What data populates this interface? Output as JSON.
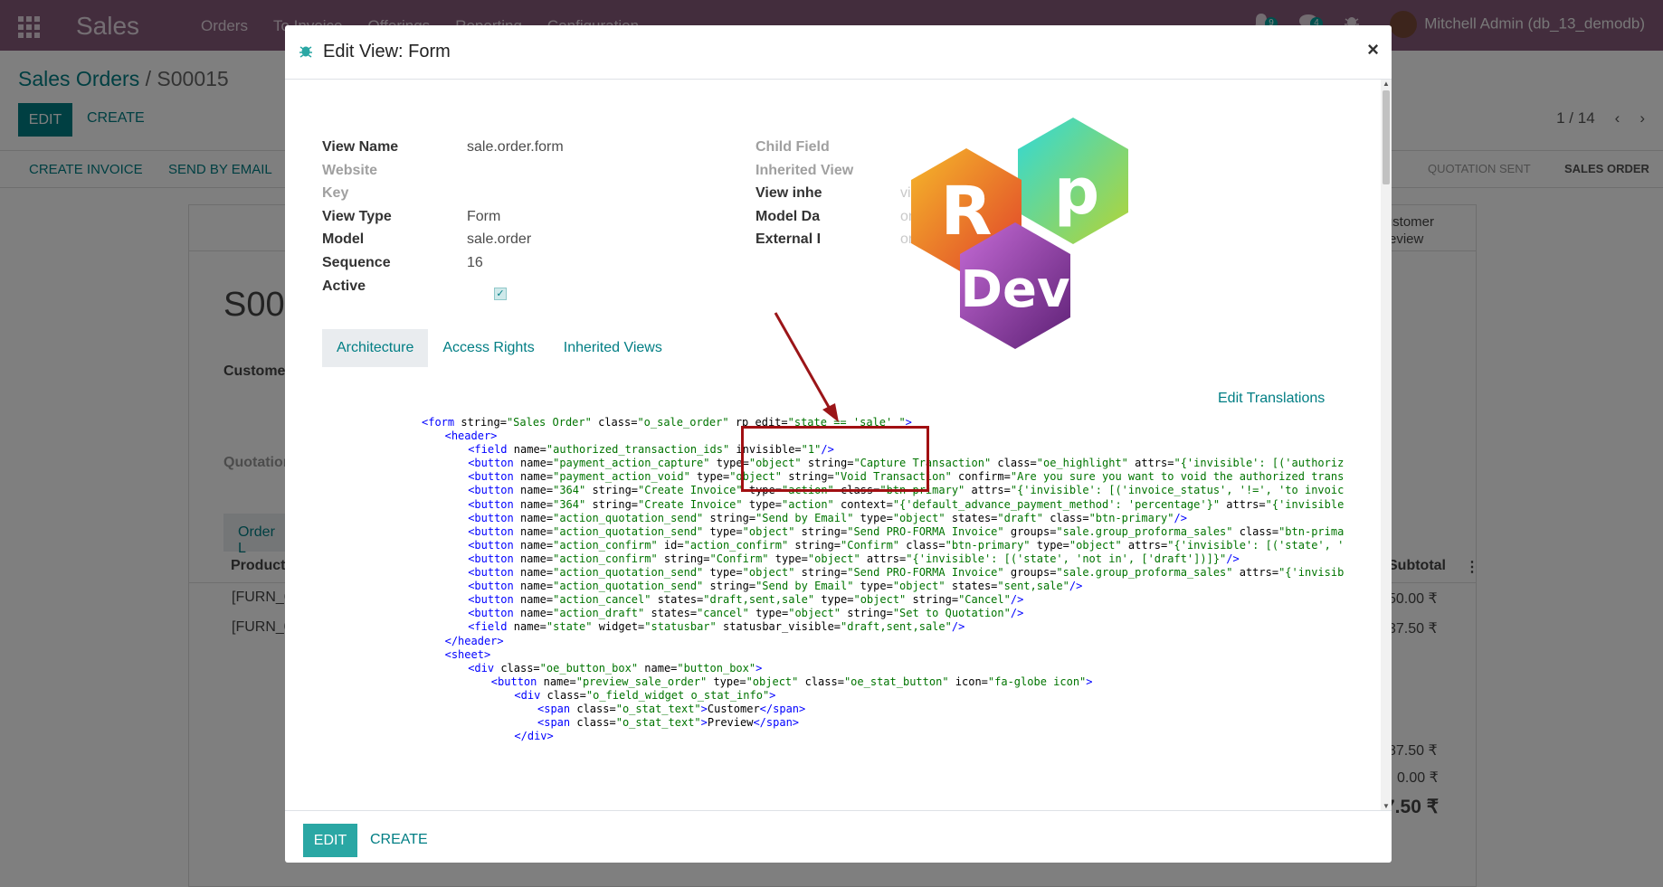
{
  "app": {
    "brand": "Sales",
    "menu": [
      "Orders",
      "To Invoice",
      "Offerings",
      "Reporting",
      "Configuration"
    ],
    "activity_badge": "9",
    "messages_badge": "4",
    "user": "Mitchell Admin (db_13_demodb)"
  },
  "breadcrumb": {
    "root": "Sales Orders",
    "separator": "/",
    "current": "S00015"
  },
  "control": {
    "edit_label": "EDIT",
    "create_label": "CREATE",
    "pager": "1 / 14"
  },
  "status_buttons": [
    "CREATE INVOICE",
    "SEND BY EMAIL"
  ],
  "statusbar": {
    "sent": "QUOTATION SENT",
    "sale": "SALES ORDER"
  },
  "background": {
    "order_number": "S00",
    "customer_label": "Customer",
    "quotation_label": "Quotation",
    "order_lines_tab": "Order L",
    "product_col": "Product",
    "subtotal_col": "Subtotal",
    "customer_preview": "Customer Preview",
    "row1": "[FURN_6",
    "row2": "[FURN_0",
    "amt1": "50.00 ₹",
    "amt2": "37.50 ₹",
    "amt3": "87.50 ₹",
    "amt4": "0.00 ₹",
    "amt5": "7.50 ₹"
  },
  "modal": {
    "title": "Edit View: Form",
    "close": "×",
    "fields_left": [
      {
        "label": "View Name",
        "value": "sale.order.form",
        "muted": false
      },
      {
        "label": "Website",
        "value": "",
        "muted": true
      },
      {
        "label": "Key",
        "value": "",
        "muted": true
      },
      {
        "label": "View Type",
        "value": "Form",
        "muted": false
      },
      {
        "label": "Model",
        "value": "sale.order",
        "muted": false
      },
      {
        "label": "Sequence",
        "value": "16",
        "muted": false
      },
      {
        "label": "Active",
        "value": "",
        "muted": false
      }
    ],
    "fields_right": [
      {
        "label": "Child Field",
        "value": "",
        "muted": true
      },
      {
        "label": "Inherited View",
        "value": "",
        "muted": true
      },
      {
        "label": "View inhe",
        "value": "view",
        "muted": false
      },
      {
        "label": "Model Da",
        "value": "order.form",
        "muted": false
      },
      {
        "label": "External I",
        "value": "order_form",
        "muted": false
      }
    ],
    "active_checked": "✓",
    "tabs": [
      "Architecture",
      "Access Rights",
      "Inherited Views"
    ],
    "edit_translations": "Edit Translations",
    "footer_edit": "EDIT",
    "footer_create": "CREATE",
    "logo_letters": [
      "R",
      "p",
      "Dev"
    ]
  },
  "code_lines": [
    [
      0,
      [
        [
          "t",
          "<form "
        ],
        [
          "a",
          "string="
        ],
        [
          "v",
          "\"Sales Order\""
        ],
        [
          "a",
          " class="
        ],
        [
          "v",
          "\"o_sale_order\""
        ],
        [
          "a",
          " rp_edit="
        ],
        [
          "v",
          "\"state == 'sale' \""
        ],
        [
          "t",
          ">"
        ]
      ]
    ],
    [
      1,
      [
        [
          "t",
          "<header>"
        ]
      ]
    ],
    [
      2,
      [
        [
          "t",
          "<field "
        ],
        [
          "a",
          "name="
        ],
        [
          "v",
          "\"authorized_transaction_ids\""
        ],
        [
          "a",
          " invisible="
        ],
        [
          "v",
          "\"1\""
        ],
        [
          "t",
          "/>"
        ]
      ]
    ],
    [
      2,
      [
        [
          "t",
          "<button "
        ],
        [
          "a",
          "name="
        ],
        [
          "v",
          "\"payment_action_capture\""
        ],
        [
          "a",
          " type="
        ],
        [
          "v",
          "\"object\""
        ],
        [
          "a",
          " string="
        ],
        [
          "v",
          "\"Capture Transaction\""
        ],
        [
          "a",
          " class="
        ],
        [
          "v",
          "\"oe_highlight\""
        ],
        [
          "a",
          " attrs="
        ],
        [
          "v",
          "\"{'invisible': [('authorized_transaction_ids', '=', [])]}\""
        ],
        [
          "t",
          "/>"
        ]
      ]
    ],
    [
      2,
      [
        [
          "t",
          "<button "
        ],
        [
          "a",
          "name="
        ],
        [
          "v",
          "\"payment_action_void\""
        ],
        [
          "a",
          " type="
        ],
        [
          "v",
          "\"object\""
        ],
        [
          "a",
          " string="
        ],
        [
          "v",
          "\"Void Transaction\""
        ],
        [
          "a",
          " confirm="
        ],
        [
          "v",
          "\"Are you sure you want to void the authorized transaction?\""
        ],
        [
          "t",
          "/>"
        ]
      ]
    ],
    [
      2,
      [
        [
          "t",
          "<button "
        ],
        [
          "a",
          "name="
        ],
        [
          "v",
          "\"364\""
        ],
        [
          "a",
          " string="
        ],
        [
          "v",
          "\"Create Invoice\""
        ],
        [
          "a",
          " type="
        ],
        [
          "v",
          "\"action\""
        ],
        [
          "a",
          " class="
        ],
        [
          "v",
          "\"btn-primary\""
        ],
        [
          "a",
          " attrs="
        ],
        [
          "v",
          "\"{'invisible': [('invoice_status', '!=', 'to invoice')]}\""
        ],
        [
          "t",
          "/>"
        ]
      ]
    ],
    [
      2,
      [
        [
          "t",
          "<button "
        ],
        [
          "a",
          "name="
        ],
        [
          "v",
          "\"364\""
        ],
        [
          "a",
          " string="
        ],
        [
          "v",
          "\"Create Invoice\""
        ],
        [
          "a",
          " type="
        ],
        [
          "v",
          "\"action\""
        ],
        [
          "a",
          " context="
        ],
        [
          "v",
          "\"{'default_advance_payment_method': 'percentage'}\""
        ],
        [
          "a",
          " attrs="
        ],
        [
          "v",
          "\"{'invisible': []}\""
        ],
        [
          "t",
          "/>"
        ]
      ]
    ],
    [
      2,
      [
        [
          "t",
          "<button "
        ],
        [
          "a",
          "name="
        ],
        [
          "v",
          "\"action_quotation_send\""
        ],
        [
          "a",
          " string="
        ],
        [
          "v",
          "\"Send by Email\""
        ],
        [
          "a",
          " type="
        ],
        [
          "v",
          "\"object\""
        ],
        [
          "a",
          " states="
        ],
        [
          "v",
          "\"draft\""
        ],
        [
          "a",
          " class="
        ],
        [
          "v",
          "\"btn-primary\""
        ],
        [
          "t",
          "/>"
        ]
      ]
    ],
    [
      2,
      [
        [
          "t",
          "<button "
        ],
        [
          "a",
          "name="
        ],
        [
          "v",
          "\"action_quotation_send\""
        ],
        [
          "a",
          " type="
        ],
        [
          "v",
          "\"object\""
        ],
        [
          "a",
          " string="
        ],
        [
          "v",
          "\"Send PRO-FORMA Invoice\""
        ],
        [
          "a",
          " groups="
        ],
        [
          "v",
          "\"sale.group_proforma_sales\""
        ],
        [
          "a",
          " class="
        ],
        [
          "v",
          "\"btn-primary\""
        ],
        [
          "t",
          "/>"
        ]
      ]
    ],
    [
      2,
      [
        [
          "t",
          "<button "
        ],
        [
          "a",
          "name="
        ],
        [
          "v",
          "\"action_confirm\""
        ],
        [
          "a",
          " id="
        ],
        [
          "v",
          "\"action_confirm\""
        ],
        [
          "a",
          " string="
        ],
        [
          "v",
          "\"Confirm\""
        ],
        [
          "a",
          " class="
        ],
        [
          "v",
          "\"btn-primary\""
        ],
        [
          "a",
          " type="
        ],
        [
          "v",
          "\"object\""
        ],
        [
          "a",
          " attrs="
        ],
        [
          "v",
          "\"{'invisible': [('state', 'not in', ['sent'])]}\""
        ],
        [
          "t",
          "/>"
        ]
      ]
    ],
    [
      2,
      [
        [
          "t",
          "<button "
        ],
        [
          "a",
          "name="
        ],
        [
          "v",
          "\"action_confirm\""
        ],
        [
          "a",
          " string="
        ],
        [
          "v",
          "\"Confirm\""
        ],
        [
          "a",
          " type="
        ],
        [
          "v",
          "\"object\""
        ],
        [
          "a",
          " attrs="
        ],
        [
          "v",
          "\"{'invisible': [('state', 'not in', ['draft'])]}\""
        ],
        [
          "t",
          "/>"
        ]
      ]
    ],
    [
      2,
      [
        [
          "t",
          "<button "
        ],
        [
          "a",
          "name="
        ],
        [
          "v",
          "\"action_quotation_send\""
        ],
        [
          "a",
          " type="
        ],
        [
          "v",
          "\"object\""
        ],
        [
          "a",
          " string="
        ],
        [
          "v",
          "\"Send PRO-FORMA Invoice\""
        ],
        [
          "a",
          " groups="
        ],
        [
          "v",
          "\"sale.group_proforma_sales\""
        ],
        [
          "a",
          " attrs="
        ],
        [
          "v",
          "\"{'invisible': []}\""
        ],
        [
          "t",
          "/>"
        ]
      ]
    ],
    [
      2,
      [
        [
          "t",
          "<button "
        ],
        [
          "a",
          "name="
        ],
        [
          "v",
          "\"action_quotation_send\""
        ],
        [
          "a",
          " string="
        ],
        [
          "v",
          "\"Send by Email\""
        ],
        [
          "a",
          " type="
        ],
        [
          "v",
          "\"object\""
        ],
        [
          "a",
          " states="
        ],
        [
          "v",
          "\"sent,sale\""
        ],
        [
          "t",
          "/>"
        ]
      ]
    ],
    [
      2,
      [
        [
          "t",
          "<button "
        ],
        [
          "a",
          "name="
        ],
        [
          "v",
          "\"action_cancel\""
        ],
        [
          "a",
          " states="
        ],
        [
          "v",
          "\"draft,sent,sale\""
        ],
        [
          "a",
          " type="
        ],
        [
          "v",
          "\"object\""
        ],
        [
          "a",
          " string="
        ],
        [
          "v",
          "\"Cancel\""
        ],
        [
          "t",
          "/>"
        ]
      ]
    ],
    [
      2,
      [
        [
          "t",
          "<button "
        ],
        [
          "a",
          "name="
        ],
        [
          "v",
          "\"action_draft\""
        ],
        [
          "a",
          " states="
        ],
        [
          "v",
          "\"cancel\""
        ],
        [
          "a",
          " type="
        ],
        [
          "v",
          "\"object\""
        ],
        [
          "a",
          " string="
        ],
        [
          "v",
          "\"Set to Quotation\""
        ],
        [
          "t",
          "/>"
        ]
      ]
    ],
    [
      2,
      [
        [
          "t",
          "<field "
        ],
        [
          "a",
          "name="
        ],
        [
          "v",
          "\"state\""
        ],
        [
          "a",
          " widget="
        ],
        [
          "v",
          "\"statusbar\""
        ],
        [
          "a",
          " statusbar_visible="
        ],
        [
          "v",
          "\"draft,sent,sale\""
        ],
        [
          "t",
          "/>"
        ]
      ]
    ],
    [
      1,
      [
        [
          "t",
          "</header>"
        ]
      ]
    ],
    [
      1,
      [
        [
          "t",
          "<sheet>"
        ]
      ]
    ],
    [
      2,
      [
        [
          "t",
          "<div "
        ],
        [
          "a",
          "class="
        ],
        [
          "v",
          "\"oe_button_box\""
        ],
        [
          "a",
          " name="
        ],
        [
          "v",
          "\"button_box\""
        ],
        [
          "t",
          ">"
        ]
      ]
    ],
    [
      3,
      [
        [
          "t",
          "<button "
        ],
        [
          "a",
          "name="
        ],
        [
          "v",
          "\"preview_sale_order\""
        ],
        [
          "a",
          " type="
        ],
        [
          "v",
          "\"object\""
        ],
        [
          "a",
          " class="
        ],
        [
          "v",
          "\"oe_stat_button\""
        ],
        [
          "a",
          " icon="
        ],
        [
          "v",
          "\"fa-globe icon\""
        ],
        [
          "t",
          ">"
        ]
      ]
    ],
    [
      4,
      [
        [
          "t",
          "<div "
        ],
        [
          "a",
          "class="
        ],
        [
          "v",
          "\"o_field_widget o_stat_info\""
        ],
        [
          "t",
          ">"
        ]
      ]
    ],
    [
      5,
      [
        [
          "t",
          "<span "
        ],
        [
          "a",
          "class="
        ],
        [
          "v",
          "\"o_stat_text\""
        ],
        [
          "t",
          ">"
        ],
        [
          "a",
          "Customer"
        ],
        [
          "t",
          "</span>"
        ]
      ]
    ],
    [
      5,
      [
        [
          "t",
          "<span "
        ],
        [
          "a",
          "class="
        ],
        [
          "v",
          "\"o_stat_text\""
        ],
        [
          "t",
          ">"
        ],
        [
          "a",
          "Preview"
        ],
        [
          "t",
          "</span>"
        ]
      ]
    ],
    [
      4,
      [
        [
          "t",
          "</div>"
        ]
      ]
    ]
  ]
}
